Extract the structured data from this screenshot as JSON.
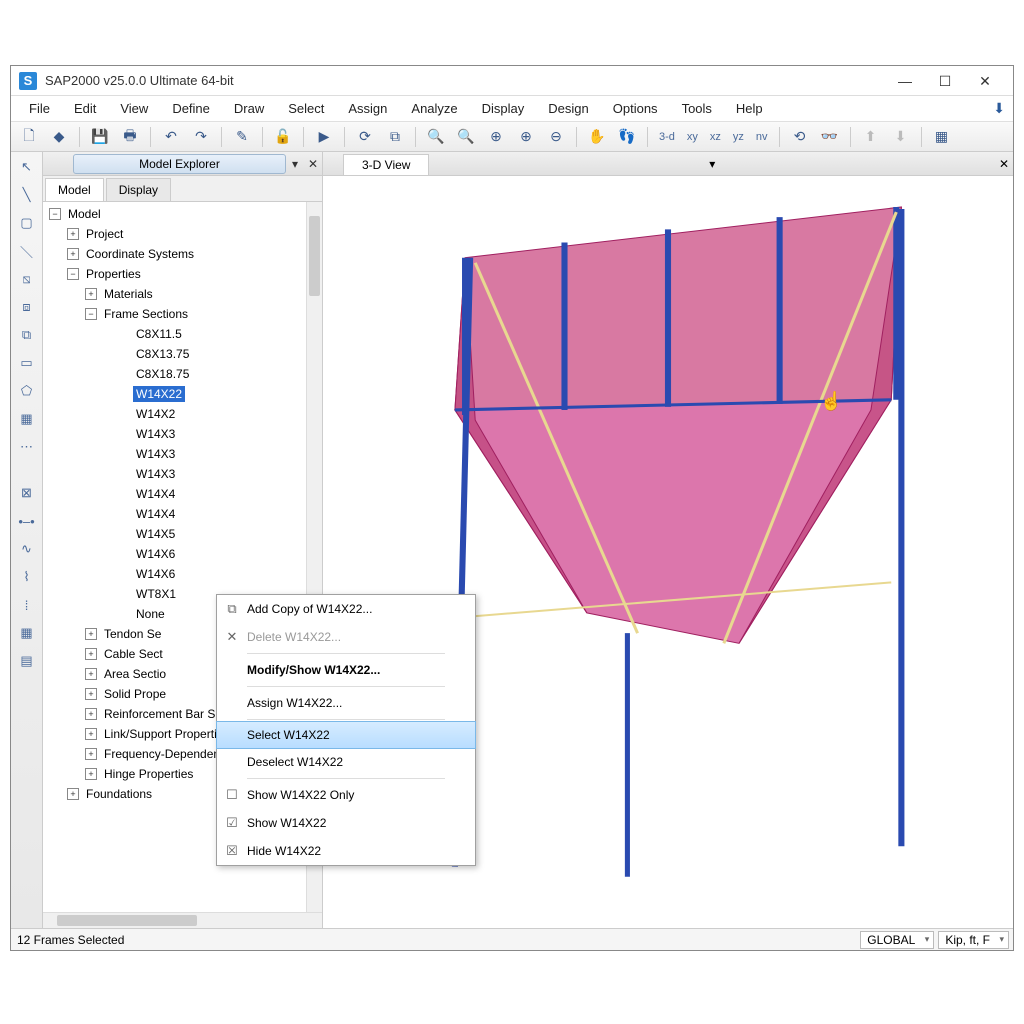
{
  "app": {
    "icon_letter": "S",
    "title": "SAP2000 v25.0.0 Ultimate 64-bit"
  },
  "window_buttons": {
    "min": "—",
    "max": "☐",
    "close": "✕"
  },
  "menu": [
    "File",
    "Edit",
    "View",
    "Define",
    "Draw",
    "Select",
    "Assign",
    "Analyze",
    "Display",
    "Design",
    "Options",
    "Tools",
    "Help"
  ],
  "toolbar_text": {
    "threeD": "3-d",
    "xy": "xy",
    "xz": "xz",
    "yz": "yz",
    "nv": "nv"
  },
  "panel": {
    "title": "Model Explorer",
    "tab_model": "Model",
    "tab_display": "Display"
  },
  "tree": {
    "root": "Model",
    "project": "Project",
    "coord": "Coordinate Systems",
    "props": "Properties",
    "materials": "Materials",
    "frame_sections": "Frame Sections",
    "fs": [
      "C8X11.5",
      "C8X13.75",
      "C8X18.75",
      "W14X22",
      "W14X2",
      "W14X3",
      "W14X3",
      "W14X3",
      "W14X4",
      "W14X4",
      "W14X5",
      "W14X6",
      "W14X6",
      "WT8X1",
      "None"
    ],
    "tendon": "Tendon Se",
    "cable": "Cable Sect",
    "area": "Area Sectio",
    "solid": "Solid Prope",
    "reinf": "Reinforcement Bar Size",
    "link": "Link/Support Properties",
    "freq": "Frequency-Dependent L",
    "hinge": "Hinge Properties",
    "foundations": "Foundations"
  },
  "view_tab": "3-D View",
  "context": {
    "add_copy": "Add Copy of W14X22...",
    "delete": "Delete W14X22...",
    "modify": "Modify/Show W14X22...",
    "assign": "Assign W14X22...",
    "select": "Select W14X22",
    "deselect": "Deselect W14X22",
    "show_only": "Show W14X22 Only",
    "show": "Show W14X22",
    "hide": "Hide W14X22"
  },
  "status": {
    "left": "12 Frames Selected",
    "coord_sys": "GLOBAL",
    "units": "Kip, ft, F"
  }
}
